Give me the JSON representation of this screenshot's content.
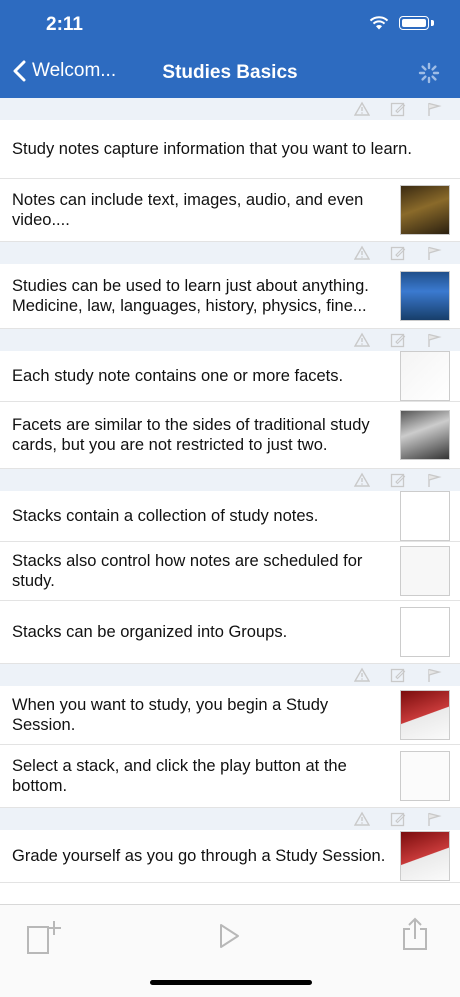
{
  "status": {
    "time": "2:11"
  },
  "nav": {
    "back_label": "Welcom...",
    "title": "Studies Basics"
  },
  "groups": [
    {
      "items": [
        {
          "text": "Study notes capture information that you want to learn.",
          "thumb": "none"
        },
        {
          "text": "Notes can include text, images, audio, and even video....",
          "thumb": "painting"
        }
      ]
    },
    {
      "items": [
        {
          "text": "Studies can be used to learn just about anything. Medicine, law, languages, history, physics, fine...",
          "thumb": "book"
        }
      ]
    },
    {
      "items": [
        {
          "text": "Each study note contains one or more facets.",
          "thumb": "facets"
        },
        {
          "text": "Facets are similar to the sides of traditional study cards, but you are not restricted to just two.",
          "thumb": "photo"
        }
      ]
    },
    {
      "items": [
        {
          "text": "Stacks contain a collection of study notes.",
          "thumb": "list"
        },
        {
          "text": "Stacks also control how notes are scheduled for study.",
          "thumb": "settings"
        },
        {
          "text": "Stacks can be organized into Groups.",
          "thumb": "groups"
        }
      ]
    },
    {
      "items": [
        {
          "text": "When you want to study, you begin a Study Session.",
          "thumb": "heart"
        },
        {
          "text": "Select a stack, and click the play button at the bottom.",
          "thumb": "doc"
        }
      ]
    },
    {
      "items": [
        {
          "text": "Grade yourself as you go through a Study Session.",
          "thumb": "heart"
        }
      ]
    }
  ],
  "toolbar": {
    "add": "add-note-icon",
    "play": "play-icon",
    "share": "share-icon"
  }
}
